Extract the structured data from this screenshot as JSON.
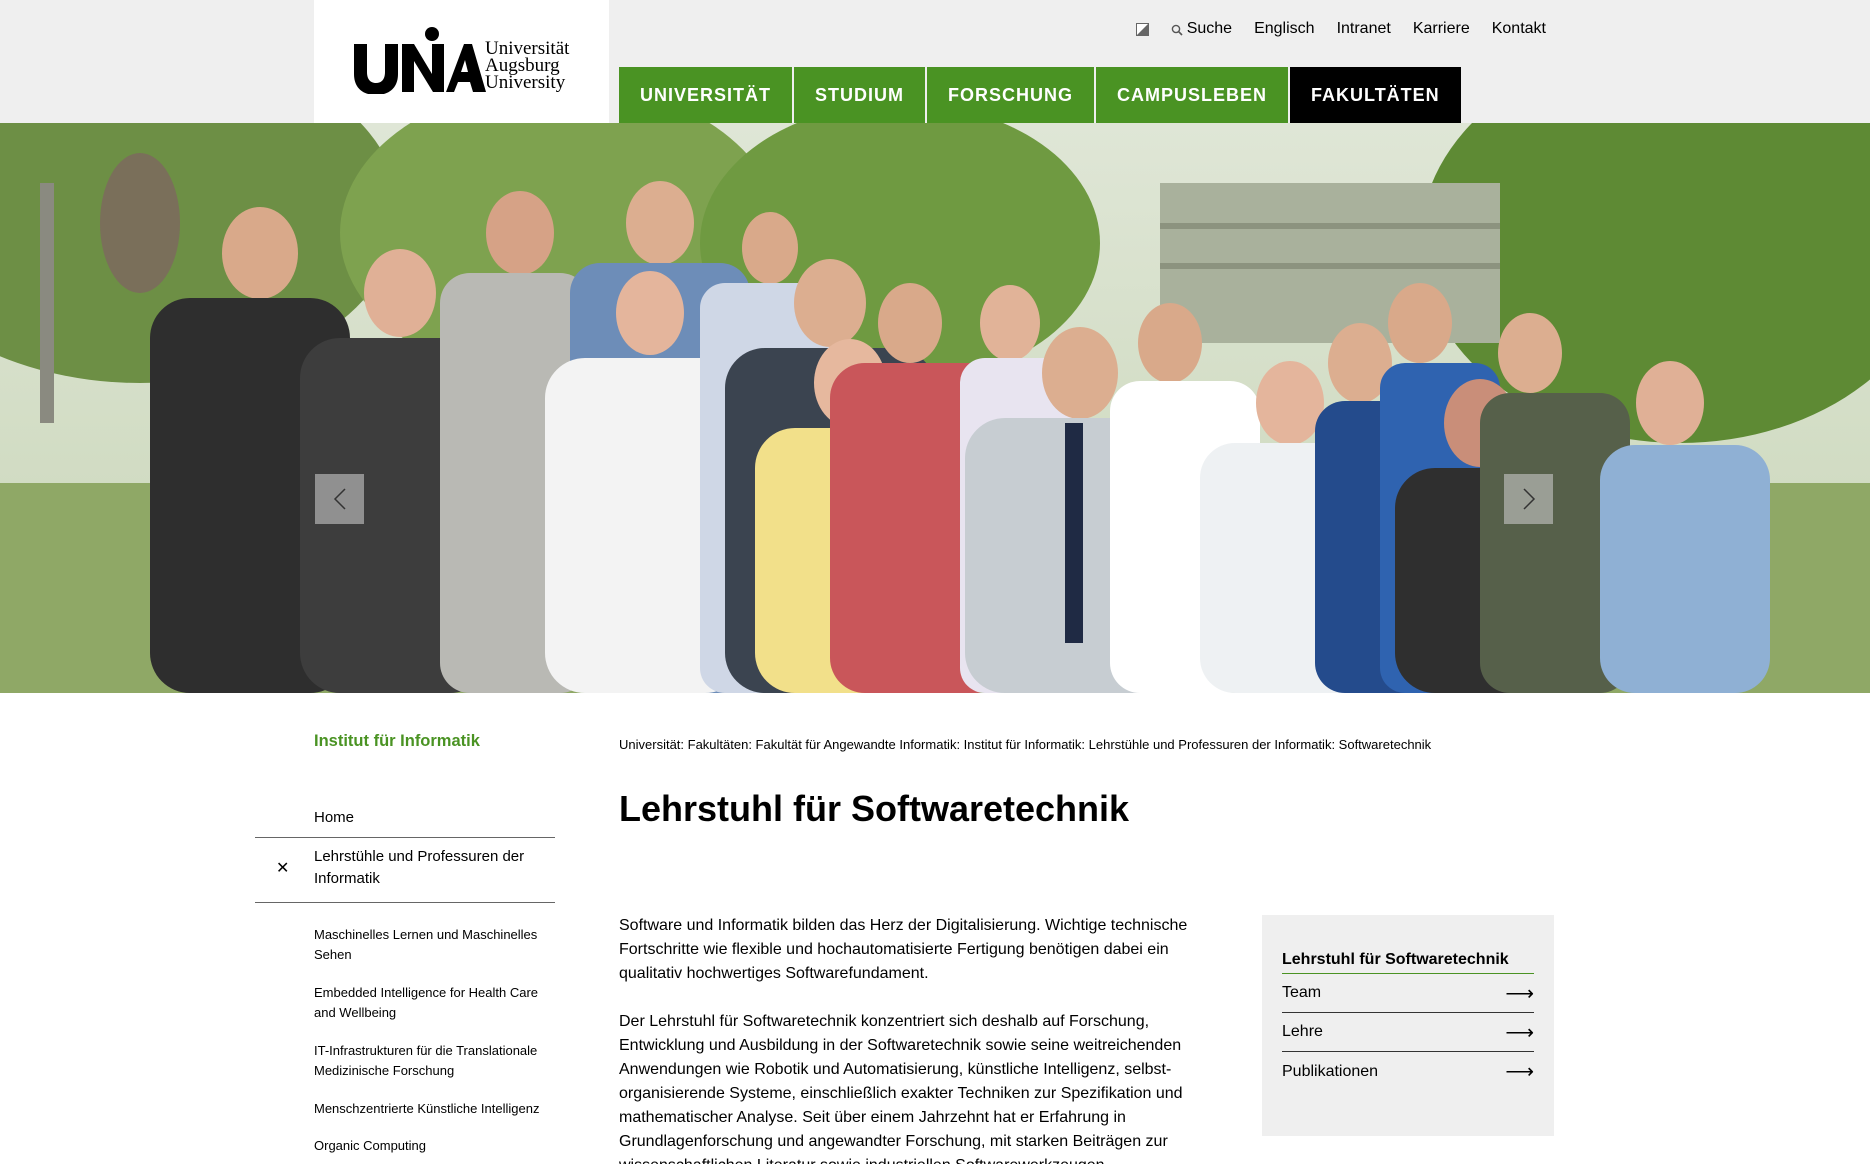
{
  "logo": {
    "line1": "Universität",
    "line2": "Augsburg",
    "line3": "University"
  },
  "meta_nav": {
    "search": "Suche",
    "english": "Englisch",
    "intranet": "Intranet",
    "karriere": "Karriere",
    "kontakt": "Kontakt"
  },
  "main_nav": [
    {
      "label": "UNIVERSITÄT",
      "active": false
    },
    {
      "label": "STUDIUM",
      "active": false
    },
    {
      "label": "FORSCHUNG",
      "active": false
    },
    {
      "label": "CAMPUSLEBEN",
      "active": false
    },
    {
      "label": "FAKULTÄTEN",
      "active": true
    }
  ],
  "sidebar": {
    "title": "Institut für Informatik",
    "home": "Home",
    "open_item": "Lehrstühle und Professuren der Informatik",
    "sub_items": [
      "Maschinelles Lernen und Maschinelles Sehen",
      "Embedded Intelligence for Health Care and Wellbeing",
      "IT-Infrastrukturen für die Translationale Medizinische Forschung",
      "Menschzentrierte Künstliche Intelligenz",
      "Organic Computing"
    ]
  },
  "breadcrumb": "Universität: Fakultäten: Fakultät für Angewandte Informatik: Institut für Informatik: Lehrstühle und Professuren der Informatik: Softwaretechnik",
  "page_title": "Lehrstuhl für Softwaretechnik",
  "intro": {
    "p1": "Software und Informatik bilden das Herz der Digitalisierung. Wichtige technische Fortschritte wie flexible und hochautomatisierte Fertigung benötigen dabei ein qualitativ hochwertiges Softwarefundament.",
    "p2": "Der Lehrstuhl für Softwaretechnik konzentriert sich deshalb auf Forschung, Entwicklung und Ausbildung in der Softwaretechnik sowie seine weitreichenden Anwendungen wie Robotik und Automatisierung, künstliche Intelligenz, selbst-organisierende Systeme, einschließlich exakter Techniken zur Spezifikation und mathematischer Analyse. Seit über einem Jahrzehnt hat er Erfahrung in Grundlagenforschung und angewandter Forschung, mit starken Beiträgen zur wissenschaftlichen Literatur sowie industriellen Softwarewerkzeugen."
  },
  "info_box": {
    "title": "Lehrstuhl für Softwaretechnik",
    "links": [
      "Team",
      "Lehre",
      "Publikationen"
    ]
  },
  "colors": {
    "brand_green": "#4a9323",
    "nav_active": "#000000",
    "header_bg": "#efefef"
  }
}
